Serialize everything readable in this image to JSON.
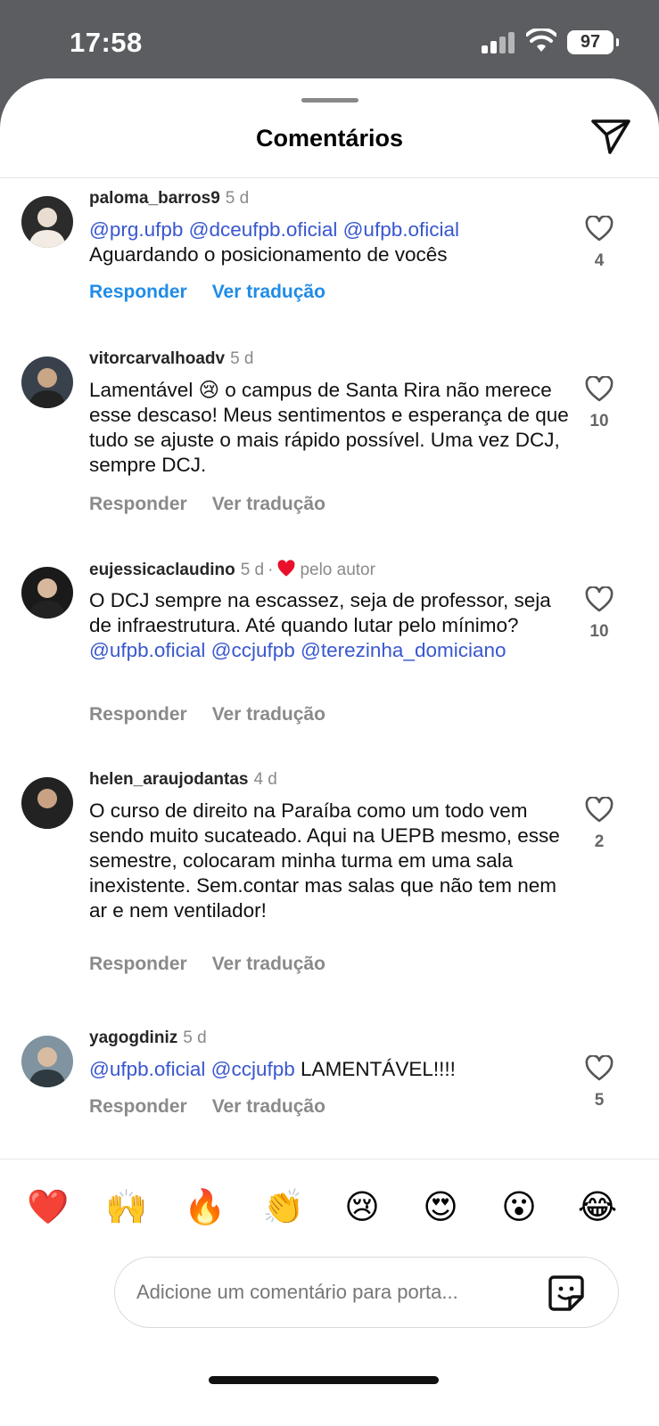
{
  "status": {
    "time": "17:58",
    "battery": "97"
  },
  "sheet": {
    "title": "Comentários"
  },
  "comments": [
    {
      "user": "paloma_barros9",
      "ago": "5 d",
      "body": [
        {
          "t": "@prg.ufpb @dceufpb.oficial @ufpb.oficial",
          "mention": true
        },
        {
          "t": "\nAguardando o posicionamento de vocês",
          "mention": false
        }
      ],
      "reply": "Responder",
      "translate": "Ver tradução",
      "likes": "4",
      "highlight_actions": true
    },
    {
      "user": "vitorcarvalhoadv",
      "ago": "5 d",
      "body": [
        {
          "t": "Lamentável 😢 o campus de Santa Rira não merece esse descaso! Meus sentimentos e esperança de que tudo se ajuste o mais rápido possível. Uma vez DCJ, sempre DCJ.",
          "mention": false
        }
      ],
      "reply": "Responder",
      "translate": "Ver tradução",
      "likes": "10"
    },
    {
      "user": "eujessicaclaudino",
      "ago": "5 d",
      "author_like": "pelo autor",
      "body": [
        {
          "t": "O DCJ sempre na escassez, seja de professor, seja de infraestrutura.  Até quando lutar pelo mínimo? ",
          "mention": false
        },
        {
          "t": "@ufpb.oficial @ccjufpb @terezinha_domiciano",
          "mention": true
        }
      ],
      "reply": "Responder",
      "translate": "Ver tradução",
      "likes": "10"
    },
    {
      "user": "helen_araujodantas",
      "ago": "4 d",
      "body": [
        {
          "t": "O curso de direito na Paraíba como um todo vem sendo muito sucateado. Aqui na UEPB mesmo, esse semestre, colocaram minha turma em uma sala inexistente. Sem.contar mas salas que não tem nem ar e nem ventilador!",
          "mention": false
        }
      ],
      "reply": "Responder",
      "translate": "Ver tradução",
      "likes": "2"
    },
    {
      "user": "yagogdiniz",
      "ago": "5 d",
      "body": [
        {
          "t": "@ufpb.oficial @ccjufpb",
          "mention": true
        },
        {
          "t": " LAMENTÁVEL!!!!",
          "mention": false
        }
      ],
      "reply": "Responder",
      "translate": "Ver tradução",
      "likes": "5"
    }
  ],
  "emoji_bar": [
    "❤️",
    "🙌",
    "🔥",
    "👏",
    "😢",
    "😍",
    "😮",
    "😂"
  ],
  "composer": {
    "placeholder": "Adicione um comentário para porta..."
  }
}
